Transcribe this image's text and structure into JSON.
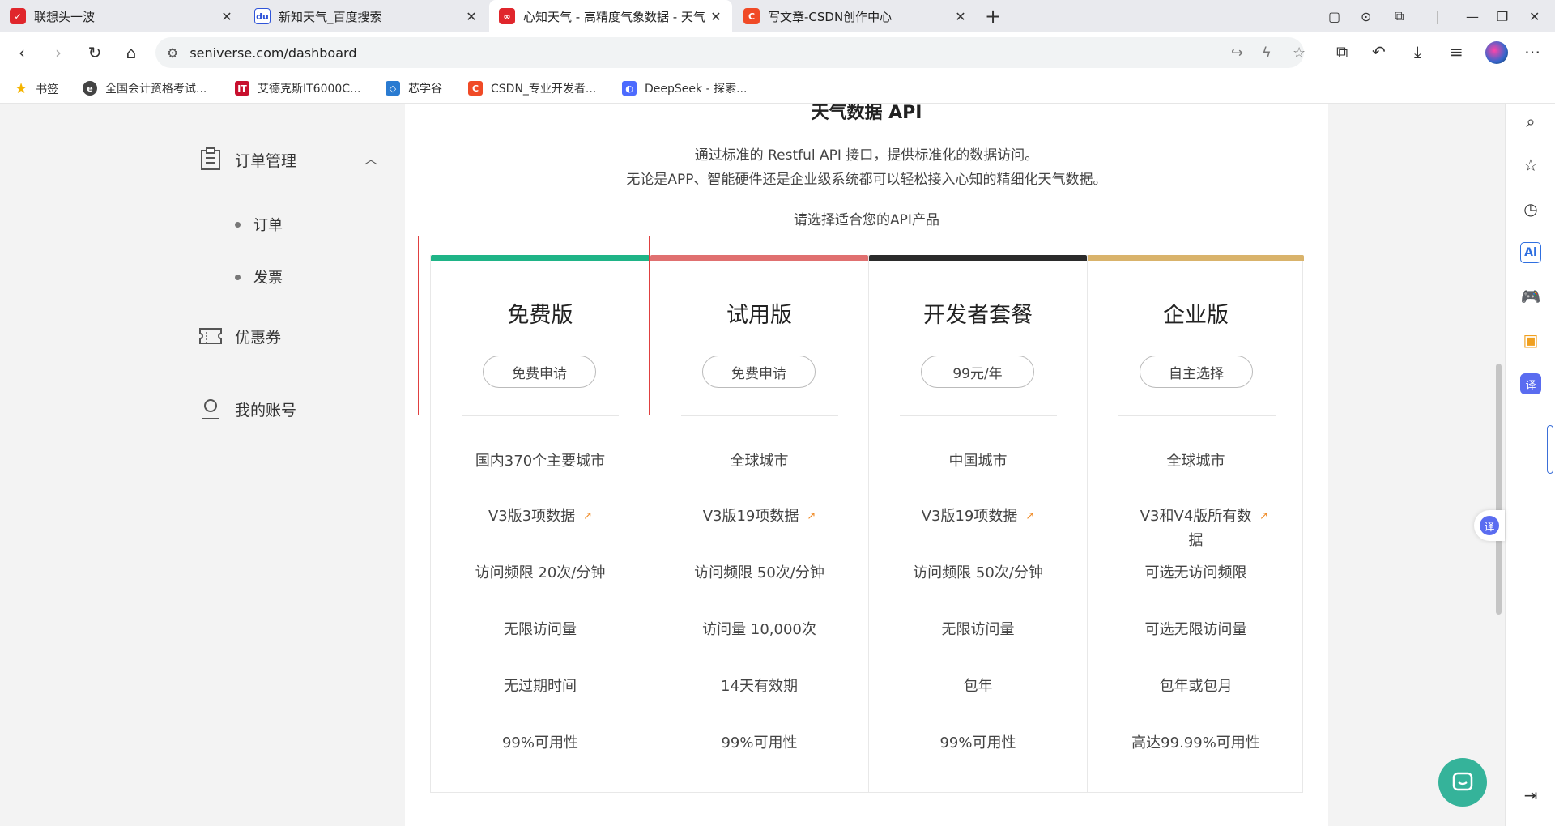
{
  "tabs": [
    {
      "title": "联想头一波",
      "favicon": "lenovo-icon",
      "color": "#e0262c"
    },
    {
      "title": "新知天气_百度搜索",
      "favicon": "baidu-icon",
      "color": "#2f54d8"
    },
    {
      "title": "心知天气 - 高精度气象数据 - 天气",
      "favicon": "seniverse-icon",
      "color": "#e0262c",
      "active": true
    },
    {
      "title": "写文章-CSDN创作中心",
      "favicon": "csdn-icon",
      "color": "#f04a26"
    }
  ],
  "address": {
    "url": "seniverse.com/dashboard"
  },
  "bookmarks": [
    {
      "label": "书签",
      "icon": "star-icon",
      "color": "#f5b400"
    },
    {
      "label": "全国会计资格考试...",
      "icon": "gov-icon",
      "color": "#444"
    },
    {
      "label": "艾德克斯IT6000C...",
      "icon": "itech-icon",
      "color": "#c8102e"
    },
    {
      "label": "芯学谷",
      "icon": "chip-icon",
      "color": "#2a7bd1"
    },
    {
      "label": "CSDN_专业开发者...",
      "icon": "csdn-icon",
      "color": "#f04a26"
    },
    {
      "label": "DeepSeek - 探索...",
      "icon": "deepseek-icon",
      "color": "#4d6bfe"
    }
  ],
  "sidebar": {
    "orders": "订单管理",
    "order": "订单",
    "invoice": "发票",
    "coupons": "优惠券",
    "account": "我的账号"
  },
  "main": {
    "title": "天气数据 API",
    "desc1": "通过标准的 Restful API 接口，提供标准化的数据访问。",
    "desc2": "无论是APP、智能硬件还是企业级系统都可以轻松接入心知的精细化天气数据。",
    "prompt": "请选择适合您的API产品"
  },
  "plans": [
    {
      "name": "免费版",
      "button": "免费申请",
      "accent": "#1fb487",
      "features": [
        "国内370个主要城市",
        "V3版3项数据",
        "访问频限 20次/分钟",
        "无限访问量",
        "无过期时间",
        "99%可用性"
      ]
    },
    {
      "name": "试用版",
      "button": "免费申请",
      "accent": "#e07070",
      "features": [
        "全球城市",
        "V3版19项数据",
        "访问频限 50次/分钟",
        "访问量 10,000次",
        "14天有效期",
        "99%可用性"
      ]
    },
    {
      "name": "开发者套餐",
      "button": "99元/年",
      "accent": "#2b2b2b",
      "features": [
        "中国城市",
        "V3版19项数据",
        "访问频限 50次/分钟",
        "无限访问量",
        "包年",
        "99%可用性"
      ]
    },
    {
      "name": "企业版",
      "button": "自主选择",
      "accent": "#d9b36b",
      "features": [
        "全球城市",
        "V3和V4版所有数据",
        "可选无访问频限",
        "可选无限访问量",
        "包年或包月",
        "高达99.99%可用性"
      ]
    }
  ]
}
